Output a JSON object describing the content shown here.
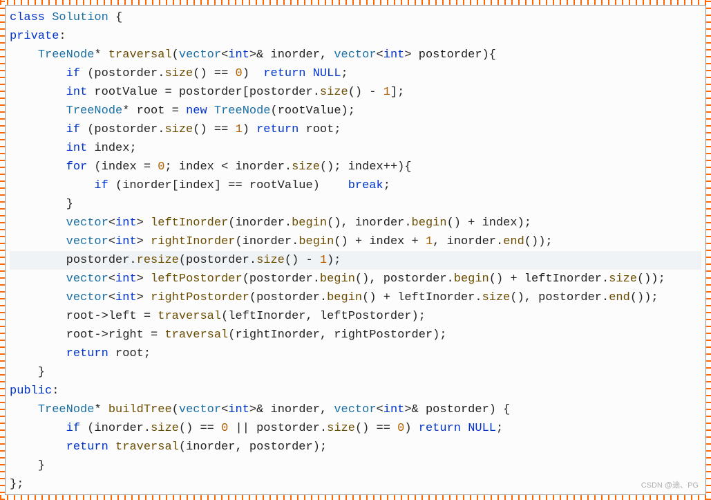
{
  "language": "C++",
  "watermark": "CSDN @途、PG",
  "code": {
    "tokens": [
      [
        [
          "kw",
          "class"
        ],
        [
          "",
          " "
        ],
        [
          "type",
          "Solution"
        ],
        [
          "",
          " {"
        ]
      ],
      [
        [
          "kw",
          "private"
        ],
        [
          "",
          ":"
        ]
      ],
      [
        [
          "",
          "    "
        ],
        [
          "type",
          "TreeNode"
        ],
        [
          "",
          "* "
        ],
        [
          "func",
          "traversal"
        ],
        [
          "",
          "("
        ],
        [
          "type",
          "vector"
        ],
        [
          "",
          "<"
        ],
        [
          "kw",
          "int"
        ],
        [
          "",
          ">& "
        ],
        [
          "",
          "inorder"
        ],
        [
          "",
          ", "
        ],
        [
          "type",
          "vector"
        ],
        [
          "",
          "<"
        ],
        [
          "kw",
          "int"
        ],
        [
          "",
          "> "
        ],
        [
          "",
          "postorder"
        ],
        [
          "",
          "){"
        ]
      ],
      [
        [
          "",
          "        "
        ],
        [
          "kw",
          "if"
        ],
        [
          "",
          " (postorder."
        ],
        [
          "func",
          "size"
        ],
        [
          "",
          "() == "
        ],
        [
          "num",
          "0"
        ],
        [
          "",
          ")  "
        ],
        [
          "kw",
          "return"
        ],
        [
          "",
          " "
        ],
        [
          "kw",
          "NULL"
        ],
        [
          "",
          ";"
        ]
      ],
      [
        [
          "",
          "        "
        ],
        [
          "kw",
          "int"
        ],
        [
          "",
          " rootValue = postorder[postorder."
        ],
        [
          "func",
          "size"
        ],
        [
          "",
          "() - "
        ],
        [
          "num",
          "1"
        ],
        [
          "",
          "];"
        ]
      ],
      [
        [
          "",
          "        "
        ],
        [
          "type",
          "TreeNode"
        ],
        [
          "",
          "* root = "
        ],
        [
          "kw",
          "new"
        ],
        [
          "",
          " "
        ],
        [
          "type",
          "TreeNode"
        ],
        [
          "",
          "(rootValue);"
        ]
      ],
      [
        [
          "",
          "        "
        ],
        [
          "kw",
          "if"
        ],
        [
          "",
          " (postorder."
        ],
        [
          "func",
          "size"
        ],
        [
          "",
          "() == "
        ],
        [
          "num",
          "1"
        ],
        [
          "",
          ") "
        ],
        [
          "kw",
          "return"
        ],
        [
          "",
          " root;"
        ]
      ],
      [
        [
          "",
          "        "
        ],
        [
          "kw",
          "int"
        ],
        [
          "",
          " index;"
        ]
      ],
      [
        [
          "",
          "        "
        ],
        [
          "kw",
          "for"
        ],
        [
          "",
          " (index = "
        ],
        [
          "num",
          "0"
        ],
        [
          "",
          "; index < inorder."
        ],
        [
          "func",
          "size"
        ],
        [
          "",
          "(); index++){"
        ]
      ],
      [
        [
          "",
          "            "
        ],
        [
          "kw",
          "if"
        ],
        [
          "",
          " (inorder[index] == rootValue)    "
        ],
        [
          "kw",
          "break"
        ],
        [
          "",
          ";"
        ]
      ],
      [
        [
          "",
          "        }"
        ]
      ],
      [
        [
          "",
          "        "
        ],
        [
          "type",
          "vector"
        ],
        [
          "",
          "<"
        ],
        [
          "kw",
          "int"
        ],
        [
          "",
          "> "
        ],
        [
          "func",
          "leftInorder"
        ],
        [
          "",
          "(inorder."
        ],
        [
          "func",
          "begin"
        ],
        [
          "",
          "(), inorder."
        ],
        [
          "func",
          "begin"
        ],
        [
          "",
          "() + index);"
        ]
      ],
      [
        [
          "",
          "        "
        ],
        [
          "type",
          "vector"
        ],
        [
          "",
          "<"
        ],
        [
          "kw",
          "int"
        ],
        [
          "",
          "> "
        ],
        [
          "func",
          "rightInorder"
        ],
        [
          "",
          "(inorder."
        ],
        [
          "func",
          "begin"
        ],
        [
          "",
          "() + index + "
        ],
        [
          "num",
          "1"
        ],
        [
          "",
          ", inorder."
        ],
        [
          "func",
          "end"
        ],
        [
          "",
          "());"
        ]
      ],
      [
        [
          "",
          "        postorder."
        ],
        [
          "func",
          "resize"
        ],
        [
          "",
          "(postorder."
        ],
        [
          "func",
          "size"
        ],
        [
          "",
          "() - "
        ],
        [
          "num",
          "1"
        ],
        [
          "",
          ");"
        ]
      ],
      [
        [
          "",
          "        "
        ],
        [
          "type",
          "vector"
        ],
        [
          "",
          "<"
        ],
        [
          "kw",
          "int"
        ],
        [
          "",
          "> "
        ],
        [
          "func",
          "leftPostorder"
        ],
        [
          "",
          "(postorder."
        ],
        [
          "func",
          "begin"
        ],
        [
          "",
          "(), postorder."
        ],
        [
          "func",
          "begin"
        ],
        [
          "",
          "() + leftInorder."
        ],
        [
          "func",
          "size"
        ],
        [
          "",
          "());"
        ]
      ],
      [
        [
          "",
          "        "
        ],
        [
          "type",
          "vector"
        ],
        [
          "",
          "<"
        ],
        [
          "kw",
          "int"
        ],
        [
          "",
          "> "
        ],
        [
          "func",
          "rightPostorder"
        ],
        [
          "",
          "(postorder."
        ],
        [
          "func",
          "begin"
        ],
        [
          "",
          "() + leftInorder."
        ],
        [
          "func",
          "size"
        ],
        [
          "",
          "(), postorder."
        ],
        [
          "func",
          "end"
        ],
        [
          "",
          "());"
        ]
      ],
      [
        [
          "",
          "        root->left = "
        ],
        [
          "func",
          "traversal"
        ],
        [
          "",
          "(leftInorder, leftPostorder);"
        ]
      ],
      [
        [
          "",
          "        root->right = "
        ],
        [
          "func",
          "traversal"
        ],
        [
          "",
          "(rightInorder, rightPostorder);"
        ]
      ],
      [
        [
          "",
          "        "
        ],
        [
          "kw",
          "return"
        ],
        [
          "",
          " root;"
        ]
      ],
      [
        [
          "",
          "    }"
        ]
      ],
      [
        [
          "kw",
          "public"
        ],
        [
          "",
          ":"
        ]
      ],
      [
        [
          "",
          "    "
        ],
        [
          "type",
          "TreeNode"
        ],
        [
          "",
          "* "
        ],
        [
          "func",
          "buildTree"
        ],
        [
          "",
          "("
        ],
        [
          "type",
          "vector"
        ],
        [
          "",
          "<"
        ],
        [
          "kw",
          "int"
        ],
        [
          "",
          ">& inorder, "
        ],
        [
          "type",
          "vector"
        ],
        [
          "",
          "<"
        ],
        [
          "kw",
          "int"
        ],
        [
          "",
          ">& postorder) {"
        ]
      ],
      [
        [
          "",
          "        "
        ],
        [
          "kw",
          "if"
        ],
        [
          "",
          " (inorder."
        ],
        [
          "func",
          "size"
        ],
        [
          "",
          "() == "
        ],
        [
          "num",
          "0"
        ],
        [
          "",
          " || postorder."
        ],
        [
          "func",
          "size"
        ],
        [
          "",
          "() == "
        ],
        [
          "num",
          "0"
        ],
        [
          "",
          ") "
        ],
        [
          "kw",
          "return"
        ],
        [
          "",
          " "
        ],
        [
          "kw",
          "NULL"
        ],
        [
          "",
          ";"
        ]
      ],
      [
        [
          "",
          "        "
        ],
        [
          "kw",
          "return"
        ],
        [
          "",
          " "
        ],
        [
          "func",
          "traversal"
        ],
        [
          "",
          "(inorder, postorder);"
        ]
      ],
      [
        [
          "",
          "    }"
        ]
      ],
      [
        [
          "",
          "};"
        ]
      ]
    ],
    "highlight_line": 13
  }
}
